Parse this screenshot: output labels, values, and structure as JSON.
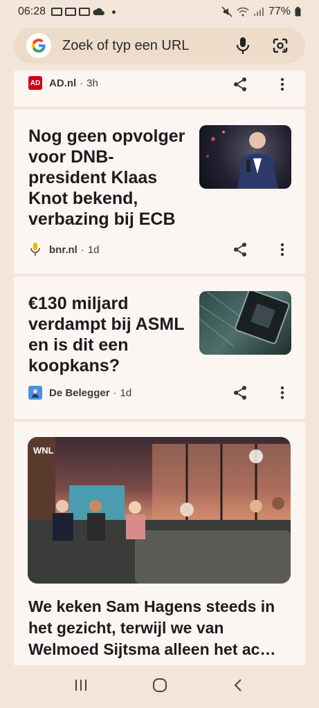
{
  "status_bar": {
    "time": "06:28",
    "battery": "77%"
  },
  "search": {
    "placeholder": "Zoek of typ een URL"
  },
  "feed": {
    "card1": {
      "source": "AD.nl",
      "age": "3h"
    },
    "card2": {
      "headline": "Nog geen opvolger voor DNB-president Klaas Knot bekend, verbazing bij ECB",
      "source": "bnr.nl",
      "age": "1d"
    },
    "card3": {
      "headline": "€130 miljard verdampt bij ASML en is dit een koopkans?",
      "source": "De Belegger",
      "age": "1d"
    },
    "card4": {
      "headline": "We keken Sam Hagens steeds in het gezicht, terwijl we van Welmoed Sijtsma alleen het ac…",
      "image_badge": "WNL"
    }
  },
  "colors": {
    "background": "#f3e5d9",
    "card": "#fcf6f2",
    "search": "#ecdcc9"
  }
}
